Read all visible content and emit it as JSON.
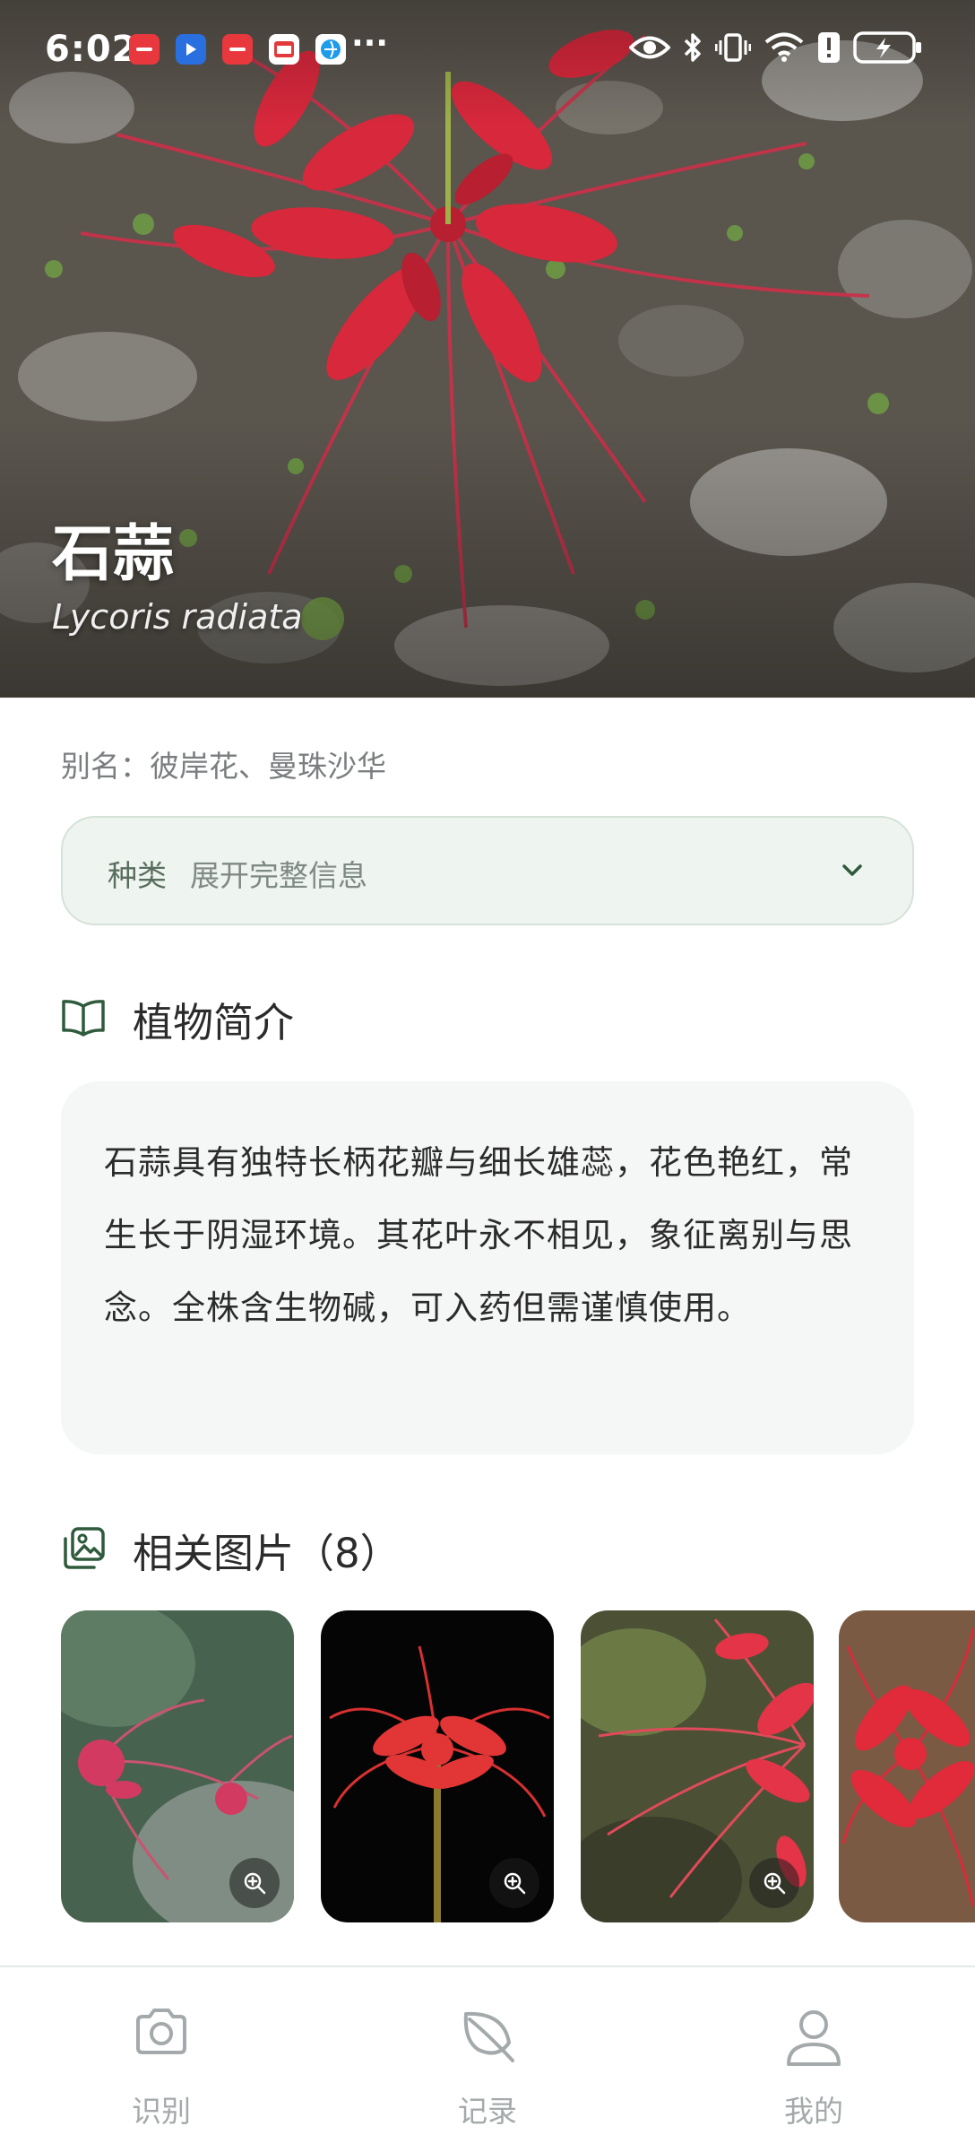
{
  "status_bar": {
    "time": "6:02",
    "more": "···",
    "app_icons": [
      "huawei-appgallery-icon",
      "arrow-app-icon",
      "huawei-store-icon",
      "mail-app-icon",
      "browser-app-icon"
    ],
    "system_icons": [
      "eye-comfort-icon",
      "bluetooth-icon",
      "vibrate-icon",
      "wifi-icon",
      "alert-icon",
      "battery-icon"
    ]
  },
  "plant": {
    "name": "石蒜",
    "latin": "Lycoris radiata",
    "alias": "别名：彼岸花、曼珠沙华"
  },
  "category": {
    "label": "种类",
    "text": "展开完整信息",
    "icon": "chevron-down-icon"
  },
  "intro": {
    "title": "植物简介",
    "icon": "book-icon",
    "text": "石蒜具有独特长柄花瓣与细长雄蕊，花色艳红，常生长于阴湿环境。其花叶永不相见，象征离别与思念。全株含生物碱，可入药但需谨慎使用。"
  },
  "images": {
    "title": "相关图片（8）",
    "icon": "gallery-icon",
    "thumbnails": [
      {
        "name": "related-image-1",
        "icon": "zoom-in-icon"
      },
      {
        "name": "related-image-2",
        "icon": "zoom-in-icon"
      },
      {
        "name": "related-image-3",
        "icon": "zoom-in-icon"
      },
      {
        "name": "related-image-4",
        "icon": "zoom-in-icon"
      }
    ]
  },
  "nav": {
    "items": [
      {
        "label": "识别",
        "icon": "camera-icon"
      },
      {
        "label": "记录",
        "icon": "leaf-icon"
      },
      {
        "label": "我的",
        "icon": "user-icon"
      }
    ]
  },
  "colors": {
    "accent": "#2f5a3c",
    "category_bg": "#eef4ef",
    "card_bg": "#f5f7f6",
    "flower_red": "#d8283c",
    "nav_inactive": "#a4a9ab"
  }
}
